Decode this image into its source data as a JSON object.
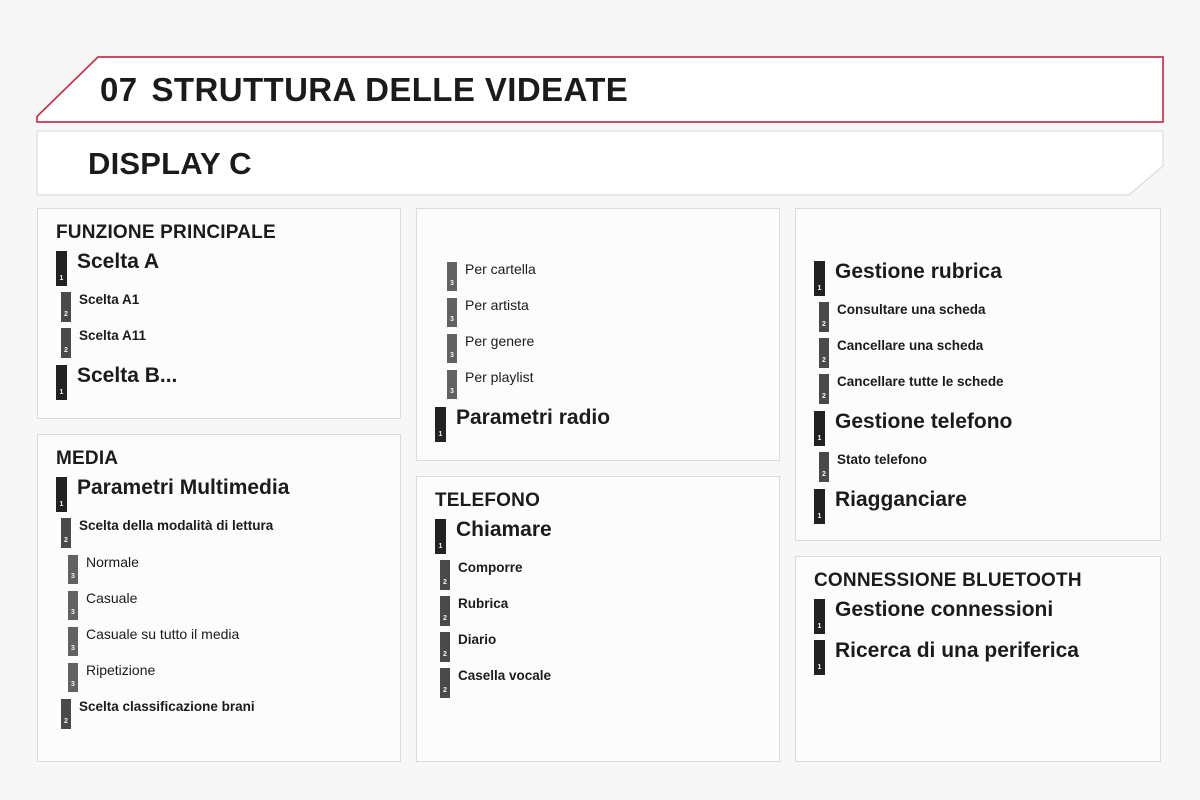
{
  "header": {
    "chapter_number": "07",
    "chapter_title": "STRUTTURA DELLE VIDEATE",
    "section_title": "DISPLAY C",
    "accent_color": "#c8334d",
    "border_color": "#dcdcdc"
  },
  "columns": [
    {
      "panels": [
        {
          "title": "FUNZIONE PRINCIPALE",
          "items": [
            {
              "level": 1,
              "label": "Scelta A"
            },
            {
              "level": 2,
              "label": "Scelta A1"
            },
            {
              "level": 2,
              "label": "Scelta A11"
            },
            {
              "level": 1,
              "label": "Scelta B..."
            }
          ]
        },
        {
          "title": "MEDIA",
          "items": [
            {
              "level": 1,
              "label": "Parametri Multimedia"
            },
            {
              "level": 2,
              "label": "Scelta della modalità di lettura"
            },
            {
              "level": 3,
              "label": "Normale"
            },
            {
              "level": 3,
              "label": "Casuale"
            },
            {
              "level": 3,
              "label": "Casuale su tutto il media"
            },
            {
              "level": 3,
              "label": "Ripetizione"
            },
            {
              "level": 2,
              "label": "Scelta classificazione brani"
            }
          ]
        }
      ]
    },
    {
      "panels": [
        {
          "title": "",
          "items": [
            {
              "level": 3,
              "label": "Per cartella"
            },
            {
              "level": 3,
              "label": "Per artista"
            },
            {
              "level": 3,
              "label": "Per genere"
            },
            {
              "level": 3,
              "label": "Per playlist"
            },
            {
              "level": 1,
              "label": "Parametri radio"
            }
          ]
        },
        {
          "title": "TELEFONO",
          "items": [
            {
              "level": 1,
              "label": "Chiamare"
            },
            {
              "level": 2,
              "label": "Comporre"
            },
            {
              "level": 2,
              "label": "Rubrica"
            },
            {
              "level": 2,
              "label": "Diario"
            },
            {
              "level": 2,
              "label": "Casella vocale"
            }
          ]
        }
      ]
    },
    {
      "panels": [
        {
          "title": "",
          "items": [
            {
              "level": 1,
              "label": "Gestione rubrica"
            },
            {
              "level": 2,
              "label": "Consultare una scheda"
            },
            {
              "level": 2,
              "label": "Cancellare una scheda"
            },
            {
              "level": 2,
              "label": "Cancellare tutte le schede"
            },
            {
              "level": 1,
              "label": "Gestione telefono"
            },
            {
              "level": 2,
              "label": "Stato telefono"
            },
            {
              "level": 1,
              "label": "Riagganciare"
            }
          ]
        },
        {
          "title": "CONNESSIONE BLUETOOTH",
          "items": [
            {
              "level": 1,
              "label": "Gestione connessioni"
            },
            {
              "level": 1,
              "label": "Ricerca di una periferica"
            }
          ]
        }
      ]
    }
  ],
  "level_badges": {
    "1": "1",
    "2": "2",
    "3": "3"
  }
}
